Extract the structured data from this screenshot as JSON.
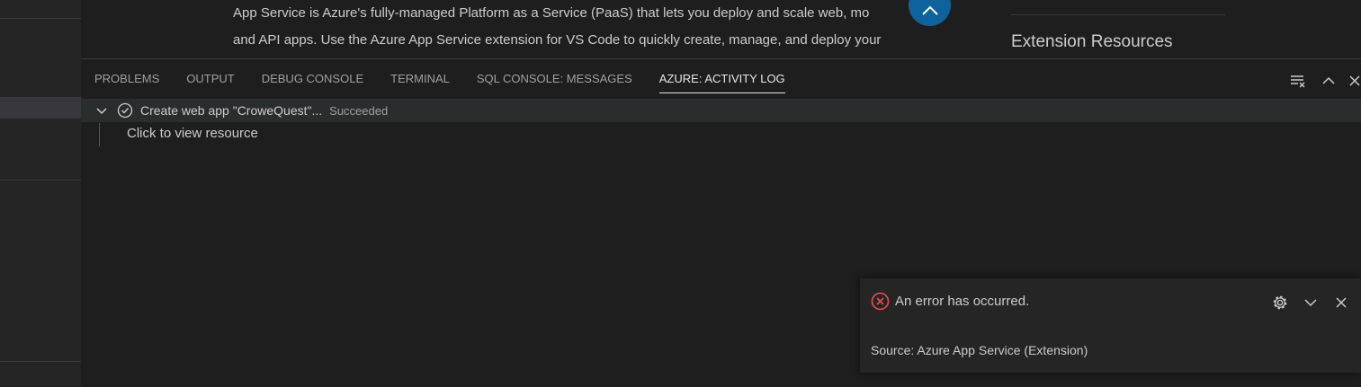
{
  "editor": {
    "line1": "App Service is Azure's fully-managed Platform as a Service (PaaS) that lets you deploy and scale web, mo",
    "line2": "and API apps. Use the Azure App Service extension for VS Code to quickly create, manage, and deploy your",
    "extension_resources": "Extension Resources"
  },
  "panel": {
    "tabs": [
      {
        "label": "PROBLEMS"
      },
      {
        "label": "OUTPUT"
      },
      {
        "label": "DEBUG CONSOLE"
      },
      {
        "label": "TERMINAL"
      },
      {
        "label": "SQL CONSOLE: MESSAGES"
      },
      {
        "label": "AZURE: ACTIVITY LOG"
      }
    ],
    "active_tab": "AZURE: ACTIVITY LOG"
  },
  "activity": {
    "item_label": "Create web app \"CroweQuest\"...",
    "item_status": "Succeeded",
    "child_label": "Click to view resource"
  },
  "notification": {
    "message": "An error has occurred.",
    "source": "Source: Azure App Service (Extension)"
  },
  "colors": {
    "accent": "#0e639c",
    "error": "#f14c4c"
  }
}
